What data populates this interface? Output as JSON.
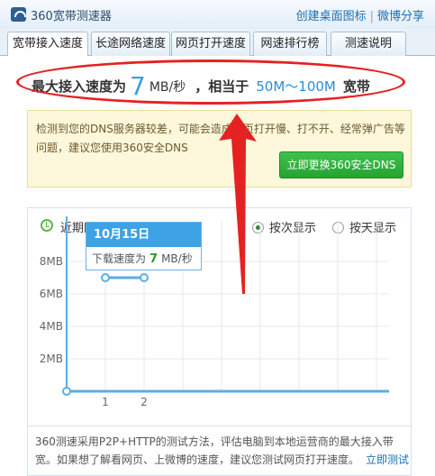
{
  "app": {
    "title": "360宽带测速器",
    "links": [
      "创建桌面图标",
      "微博分享"
    ]
  },
  "tabs": [
    {
      "label": "宽带接入速度",
      "active": true
    },
    {
      "label": "长途网络速度",
      "active": false
    },
    {
      "label": "网页打开速度",
      "active": false
    },
    {
      "label": "网速排行榜",
      "active": false
    },
    {
      "label": "测速说明",
      "active": false
    }
  ],
  "result": {
    "prefix": "最大接入速度为",
    "speed": "7",
    "unit": "MB/秒",
    "equiv": "，相当于",
    "range": "50M～100M",
    "suffix": "宽带"
  },
  "warning": {
    "text": "检测到您的DNS服务器较差，可能会造成网页打开慢、打不开、经常弹广告等问题，建议您使用360安全DNS",
    "button": "立即更换360安全DNS"
  },
  "chart_panel": {
    "title": "近期网速",
    "radios": [
      {
        "label": "按次显示",
        "checked": true
      },
      {
        "label": "按天显示",
        "checked": false
      }
    ],
    "tooltip": {
      "date": "10月15日",
      "label": "下载速度为",
      "value": "7",
      "unit": "MB/秒"
    }
  },
  "chart_data": {
    "type": "line",
    "x": [
      1,
      2
    ],
    "y": [
      7,
      7
    ],
    "y_ticks": [
      "2MB",
      "4MB",
      "6MB",
      "8MB"
    ],
    "x_ticks": [
      "1",
      "2"
    ],
    "ylim": [
      0,
      10
    ],
    "grid": true,
    "series_color": "#5aaee6"
  },
  "footer": {
    "text": "360测速采用P2P+HTTP的测试方法，评估电脑到本地运营商的最大接入带宽。如果想了解看网页、上微博的速度，建议您测试网页打开速度。",
    "link": "立即测试"
  },
  "colors": {
    "accent": "#3da2e6",
    "annotation": "#e52222",
    "button_green": "#2fb23d"
  }
}
